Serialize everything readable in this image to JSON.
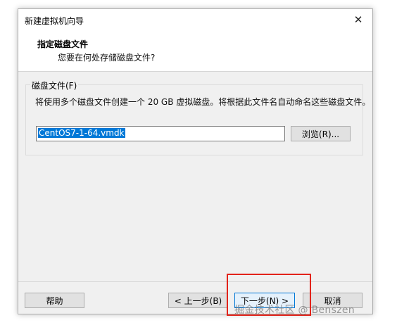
{
  "window": {
    "title": "新建虚拟机向导",
    "close_glyph": "✕"
  },
  "header": {
    "title": "指定磁盘文件",
    "subtitle": "您要在何处存储磁盘文件?"
  },
  "disk_file": {
    "group_label": "磁盘文件(F)",
    "description": "将使用多个磁盘文件创建一个 20 GB 虚拟磁盘。将根据此文件名自动命名这些磁盘文件。",
    "value": "CentOS7-1-64.vmdk",
    "browse_label": "浏览(R)..."
  },
  "footer": {
    "help_label": "帮助",
    "back_label": "< 上一步(B)",
    "next_label": "下一步(N) >",
    "cancel_label": "取消"
  },
  "annotations": {
    "highlight_color": "#e2231a",
    "watermark": "掘金技术社区 @ Benszen"
  }
}
